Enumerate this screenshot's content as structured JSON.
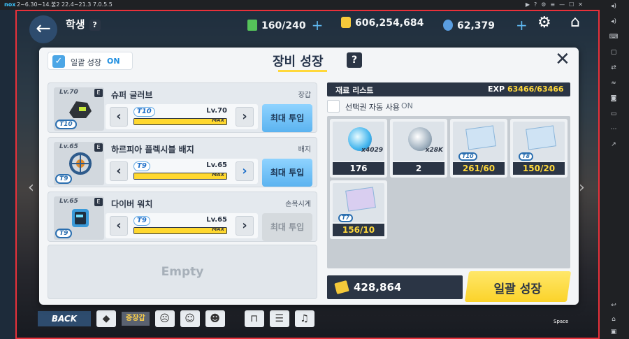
{
  "emulator": {
    "logo": "nox",
    "version": "2~6.30~14.불2 22.4~21.3 7.0.5.5"
  },
  "hud": {
    "title": "학생",
    "help": "?",
    "ap": "160/240",
    "credits": "606,254,684",
    "gems": "62,379"
  },
  "modal": {
    "bulk_label": "일괄 성장",
    "bulk_state": "ON",
    "title": "장비 성장",
    "help": "?",
    "equipment": [
      {
        "lv": "Lv.70",
        "grade": "E",
        "tier": "T10",
        "name": "슈퍼 글러브",
        "type": "장갑",
        "ctrl_tier": "T10",
        "ctrl_lv": "Lv.70",
        "exp_fill": 1.0,
        "max": "MAX",
        "button": "최대 투입",
        "button_active": true
      },
      {
        "lv": "Lv.65",
        "grade": "E",
        "tier": "T9",
        "name": "하르피아 플렉시블 배지",
        "type": "배지",
        "ctrl_tier": "T9",
        "ctrl_lv": "Lv.65",
        "exp_fill": 1.0,
        "max": "MAX",
        "button": "최대 투입",
        "button_active": true
      },
      {
        "lv": "Lv.65",
        "grade": "E",
        "tier": "T9",
        "name": "다이버 워치",
        "type": "손목시계",
        "ctrl_tier": "T9",
        "ctrl_lv": "Lv.65",
        "exp_fill": 1.0,
        "max": "MAX",
        "button": "최대 투입",
        "button_active": false
      }
    ],
    "empty_label": "Empty",
    "materials_header": "재료 리스트",
    "exp_label": "EXP",
    "exp_value": "63466/63466",
    "ticket_label": "선택권 자동 사용",
    "ticket_state": "ON",
    "materials": [
      {
        "qty": "x4029",
        "count": "176",
        "tier": "",
        "kind": "orb-blue"
      },
      {
        "qty": "x28K",
        "count": "2",
        "tier": "",
        "kind": "orb-gray"
      },
      {
        "qty": "",
        "count": "261/60",
        "tier": "T10",
        "kind": "blueprint"
      },
      {
        "qty": "",
        "count": "150/20",
        "tier": "T8",
        "kind": "blueprint"
      },
      {
        "qty": "",
        "count": "156/10",
        "tier": "T7",
        "kind": "blueprint"
      }
    ],
    "credit_value": "428,864",
    "grow_button": "일괄 성장"
  },
  "bottom": {
    "back": "BACK",
    "tag": "중장갑",
    "space": "Space"
  },
  "colors": {
    "accent_yellow": "#ffd83b",
    "navy": "#2b3545",
    "blue": "#5bb3f0",
    "frame_red": "#e8313a"
  }
}
